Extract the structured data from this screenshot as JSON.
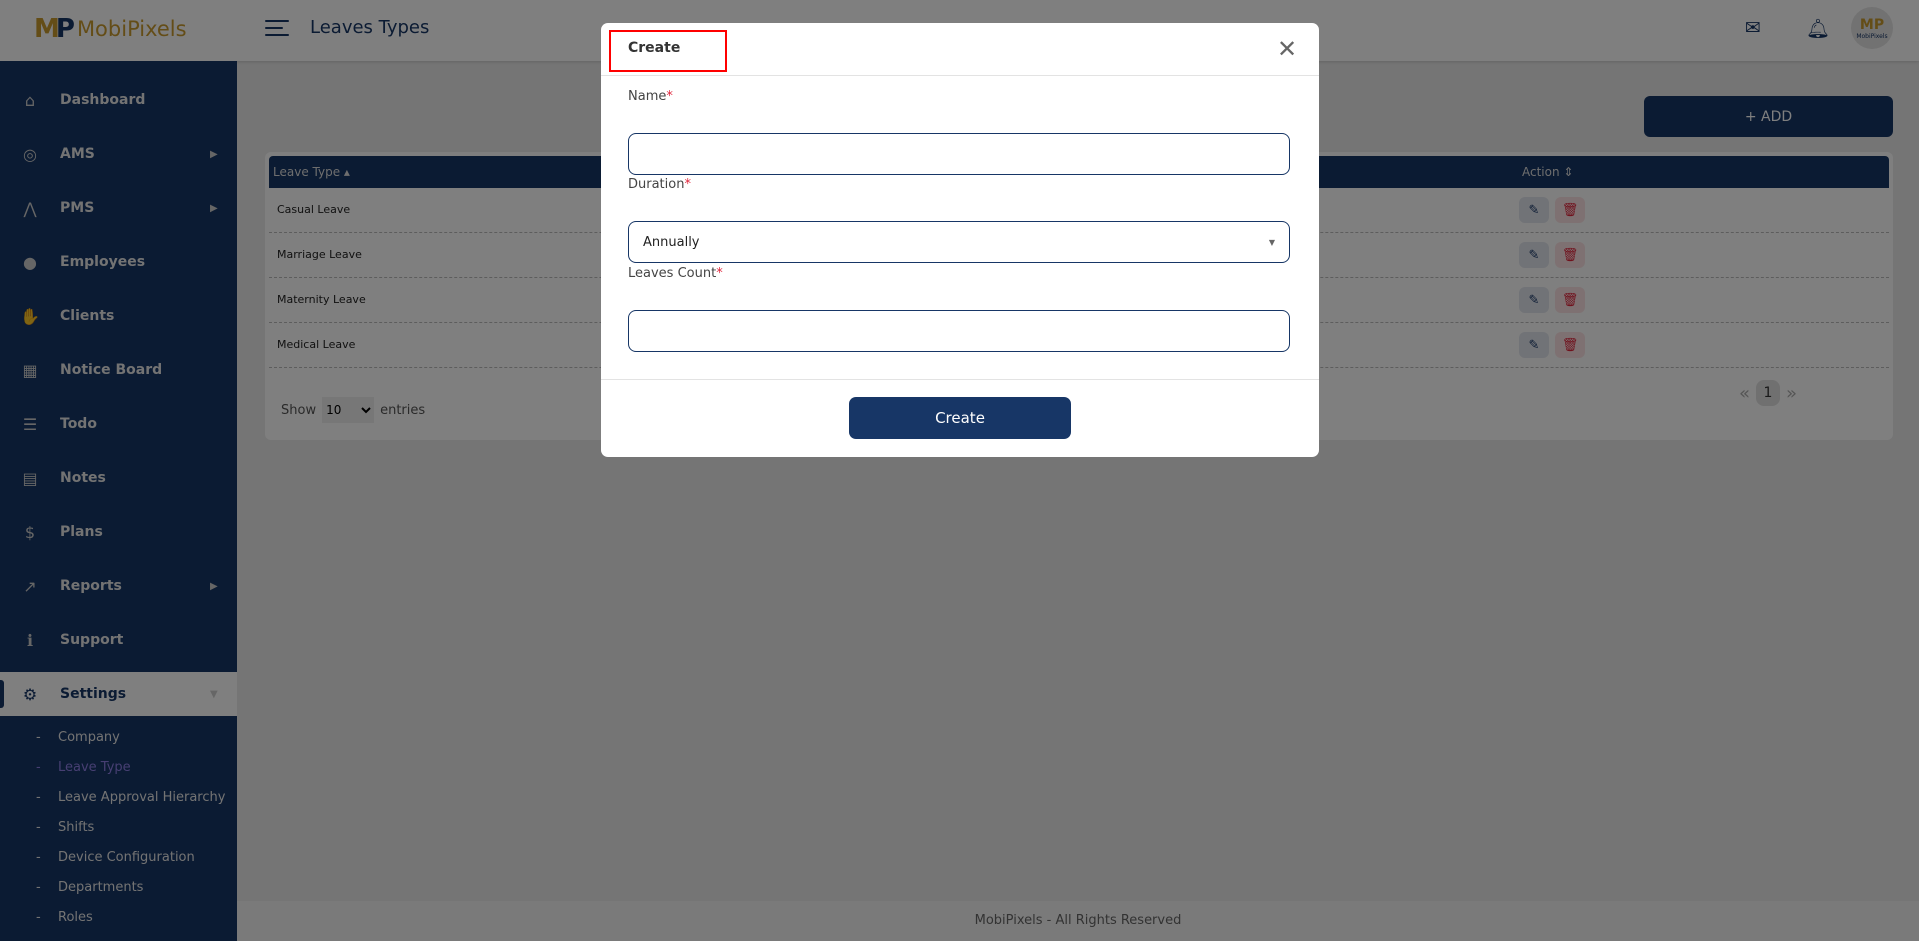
{
  "brand": {
    "name": "MobiPixels",
    "logo_mark": "MP",
    "gold": "#c99a2e",
    "navy": "#173666"
  },
  "header": {
    "title": "Leaves Types",
    "icons": [
      "menu-icon",
      "mail-icon",
      "bell-icon"
    ],
    "avatar_text": "MobiPixels"
  },
  "sidebar": {
    "items": [
      {
        "label": "Dashboard",
        "icon": "home-icon",
        "arrow": ""
      },
      {
        "label": "AMS",
        "icon": "fingerprint-icon",
        "arrow": "▶"
      },
      {
        "label": "PMS",
        "icon": "vector-icon",
        "arrow": "▶"
      },
      {
        "label": "Employees",
        "icon": "user-icon",
        "arrow": ""
      },
      {
        "label": "Clients",
        "icon": "handshake-icon",
        "arrow": ""
      },
      {
        "label": "Notice Board",
        "icon": "calendar-icon",
        "arrow": ""
      },
      {
        "label": "Todo",
        "icon": "checklist-icon",
        "arrow": ""
      },
      {
        "label": "Notes",
        "icon": "file-icon",
        "arrow": ""
      },
      {
        "label": "Plans",
        "icon": "dollar-icon",
        "arrow": ""
      },
      {
        "label": "Reports",
        "icon": "chart-icon",
        "arrow": "▶"
      },
      {
        "label": "Support",
        "icon": "info-icon",
        "arrow": ""
      },
      {
        "label": "Settings",
        "icon": "gear-icon",
        "arrow": "▼"
      }
    ],
    "sub_items": [
      "Company",
      "Leave Type",
      "Leave Approval Hierarchy",
      "Shifts",
      "Device Configuration",
      "Departments",
      "Roles"
    ]
  },
  "main": {
    "add_label": "+ ADD",
    "table": {
      "headers": [
        "Leave Type ▴",
        "Action ⇕"
      ],
      "rows": [
        "Casual Leave",
        "Marriage Leave",
        "Maternity Leave",
        "Medical Leave"
      ]
    },
    "show_label": "Show",
    "entries_value": "10",
    "entries_label": "entries",
    "pager": {
      "prev": "«",
      "page": "1",
      "next": "»"
    }
  },
  "footer": "MobiPixels - All Rights Reserved",
  "modal": {
    "title": "Create",
    "close": "✕",
    "name_label": "Name",
    "name_value": "",
    "duration_label": "Duration",
    "duration_value": "Annually",
    "count_label": "Leaves Count",
    "count_value": "",
    "required": "*",
    "submit": "Create"
  }
}
